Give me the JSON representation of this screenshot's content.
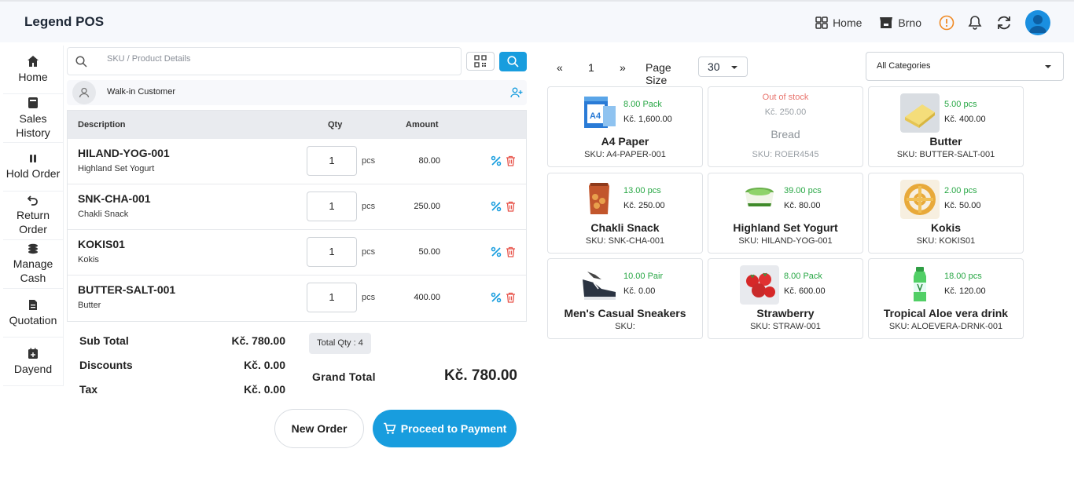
{
  "app": {
    "title": "Legend POS"
  },
  "topbar": {
    "home_label": "Home",
    "store_label": "Brno"
  },
  "sidebar": {
    "items": [
      {
        "label": "Home",
        "icon": "house-icon"
      },
      {
        "label": "Sales History",
        "icon": "book-icon"
      },
      {
        "label": "Hold Order",
        "icon": "pause-icon"
      },
      {
        "label": "Return Order",
        "icon": "return-icon"
      },
      {
        "label": "Manage Cash",
        "icon": "coins-icon"
      },
      {
        "label": "Quotation",
        "icon": "document-icon"
      },
      {
        "label": "Dayend",
        "icon": "calendar-plus-icon"
      }
    ]
  },
  "search": {
    "placeholder": "SKU / Product Details",
    "value": ""
  },
  "customer": {
    "name": "Walk-in Customer"
  },
  "cart": {
    "headers": {
      "description": "Description",
      "qty": "Qty",
      "amount": "Amount"
    },
    "rows": [
      {
        "sku": "HILAND-YOG-001",
        "name": "Highland Set Yogurt",
        "qty": "1",
        "unit": "pcs",
        "amount": "80.00"
      },
      {
        "sku": "SNK-CHA-001",
        "name": "Chakli Snack",
        "qty": "1",
        "unit": "pcs",
        "amount": "250.00"
      },
      {
        "sku": "KOKIS01",
        "name": "Kokis",
        "qty": "1",
        "unit": "pcs",
        "amount": "50.00"
      },
      {
        "sku": "BUTTER-SALT-001",
        "name": "Butter",
        "qty": "1",
        "unit": "pcs",
        "amount": "400.00"
      }
    ]
  },
  "totals": {
    "sub_total_label": "Sub Total",
    "sub_total": "Kč. 780.00",
    "discounts_label": "Discounts",
    "discounts": "Kč. 0.00",
    "tax_label": "Tax",
    "tax": "Kč. 0.00",
    "total_qty": "Total Qty : 4",
    "grand_total_label": "Grand Total",
    "grand_total": "Kč. 780.00"
  },
  "actions": {
    "new_order": "New Order",
    "proceed": "Proceed to Payment"
  },
  "pager": {
    "prev": "«",
    "page": "1",
    "next": "»",
    "page_size_label": "Page Size",
    "page_size": "30"
  },
  "category": {
    "selected": "All Categories"
  },
  "colors": {
    "accent": "#189dde",
    "in_stock": "#28a745",
    "out_of_stock": "#e8736c"
  },
  "products": [
    {
      "name": "A4 Paper",
      "sku": "SKU: A4-PAPER-001",
      "stock": "8.00 Pack",
      "price": "Kč. 1,600.00",
      "image": "paper-image"
    },
    {
      "name": "Bread",
      "sku": "SKU: ROER4545",
      "stock": "Out of stock",
      "price": "Kč. 250.00",
      "out_of_stock": true
    },
    {
      "name": "Butter",
      "sku": "SKU: BUTTER-SALT-001",
      "stock": "5.00 pcs",
      "price": "Kč. 400.00",
      "image": "butter-image"
    },
    {
      "name": "Chakli Snack",
      "sku": "SKU: SNK-CHA-001",
      "stock": "13.00 pcs",
      "price": "Kč. 250.00",
      "image": "snack-image"
    },
    {
      "name": "Highland Set Yogurt",
      "sku": "SKU: HILAND-YOG-001",
      "stock": "39.00 pcs",
      "price": "Kč. 80.00",
      "image": "yogurt-image"
    },
    {
      "name": "Kokis",
      "sku": "SKU: KOKIS01",
      "stock": "2.00 pcs",
      "price": "Kč. 50.00",
      "image": "kokis-image"
    },
    {
      "name": "Men's Casual Sneakers",
      "sku": "SKU:",
      "stock": "10.00 Pair",
      "price": "Kč. 0.00",
      "image": "sneaker-image"
    },
    {
      "name": "Strawberry",
      "sku": "SKU: STRAW-001",
      "stock": "8.00 Pack",
      "price": "Kč. 600.00",
      "image": "strawberry-image"
    },
    {
      "name": "Tropical Aloe vera drink",
      "sku": "SKU: ALOEVERA-DRNK-001",
      "stock": "18.00 pcs",
      "price": "Kč. 120.00",
      "image": "drink-image"
    }
  ]
}
